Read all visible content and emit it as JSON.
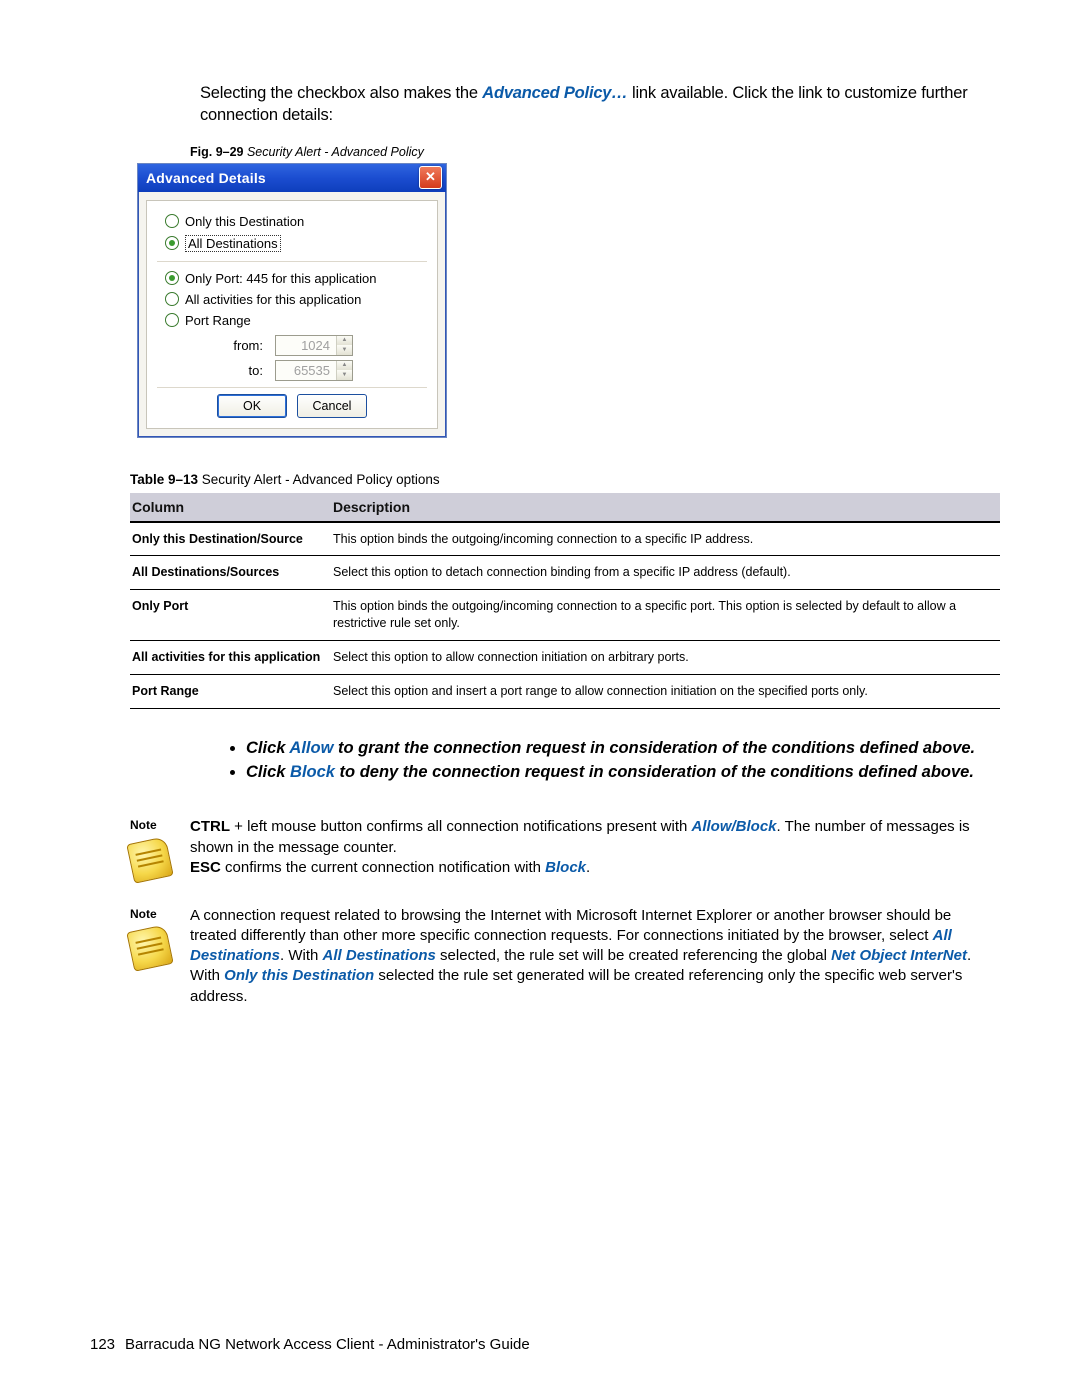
{
  "intro": {
    "pre": "Selecting the checkbox also makes the ",
    "link": "Advanced Policy…",
    "post": " link available. Click the link to customize further connection details:"
  },
  "figure": {
    "label": "Fig. 9–29",
    "title": " Security Alert - Advanced Policy"
  },
  "dialog": {
    "title": "Advanced Details",
    "close": "✕",
    "opt_only_this_dest": "Only this Destination",
    "opt_all_dest": "All Destinations",
    "opt_only_port": "Only Port: 445 for this application",
    "opt_all_activities": "All activities for this application",
    "opt_port_range": "Port Range",
    "from_label": "from:",
    "to_label": "to:",
    "from_value": "1024",
    "to_value": "65535",
    "ok": "OK",
    "cancel": "Cancel"
  },
  "table_caption": {
    "label": "Table 9–13",
    "title": " Security Alert - Advanced Policy options"
  },
  "table": {
    "h0": "Column",
    "h1": "Description",
    "rows": [
      {
        "c0": "Only this Destination/Source",
        "c1": "This option binds the outgoing/incoming connection to a specific IP address."
      },
      {
        "c0": "All Destinations/Sources",
        "c1": "Select this option to detach connection binding from a specific IP address (default)."
      },
      {
        "c0": "Only Port",
        "c1": "This option binds the outgoing/incoming connection to a specific port. This option is selected by default to allow a restrictive rule set only."
      },
      {
        "c0": "All activities for this application",
        "c1": "Select this option to allow connection initiation on arbitrary ports."
      },
      {
        "c0": "Port Range",
        "c1": "Select this option and insert a port range to allow connection initiation on the specified ports only."
      }
    ]
  },
  "actions": {
    "b1_pre": "Click ",
    "b1_kw": "Allow",
    "b1_post": " to grant the connection request in consideration of the conditions defined above.",
    "b2_pre": "Click ",
    "b2_kw": "Block",
    "b2_post": " to deny the connection request in consideration of the conditions defined above."
  },
  "note1": {
    "label": "Note",
    "t1a": "CTRL",
    "t1b": " + left mouse button confirms all connection notifications present with ",
    "t1c": "Allow/Block",
    "t1d": ". The number of messages is shown in the message counter.",
    "t2a": "ESC",
    "t2b": " confirms the current connection notification with ",
    "t2c": "Block",
    "t2d": "."
  },
  "note2": {
    "label": "Note",
    "s1": "A connection request related to browsing the Internet with Microsoft Internet Explorer or another browser should be treated differently than other more specific connection requests. For connections initiated by the browser, select ",
    "kw1": "All Destinations",
    "s2": ". With ",
    "kw2": "All Destinations",
    "s3": " selected, the rule set will be created referencing the global ",
    "kw3": "Net Object InterNet",
    "s4": ". With ",
    "kw4": "Only this Destination",
    "s5": " selected the rule set generated will be created referencing only the specific web server's address."
  },
  "footer": {
    "page": "123",
    "title": "Barracuda NG Network Access Client - Administrator's Guide"
  }
}
